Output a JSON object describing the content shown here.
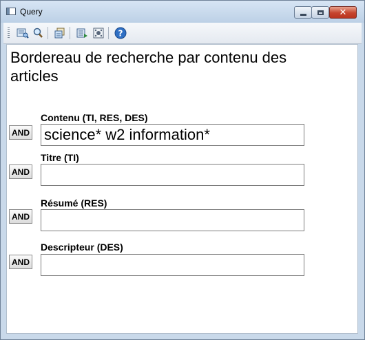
{
  "window": {
    "title": "Query"
  },
  "heading": "Bordereau de recherche par contenu des articles",
  "fields": [
    {
      "label": "Contenu (TI, RES, DES)",
      "value": "science* w2 information*",
      "operator": "AND"
    },
    {
      "label": "Titre (TI)",
      "value": "",
      "operator": "AND"
    },
    {
      "label": "Résumé (RES)",
      "value": "",
      "operator": "AND"
    },
    {
      "label": "Descripteur (DES)",
      "value": "",
      "operator": "AND"
    }
  ],
  "toolbar": {
    "icons": [
      "search-form-icon",
      "magnifier-icon",
      "history-icon",
      "export-icon",
      "settings-icon",
      "help-icon"
    ]
  },
  "colors": {
    "titlebar": "#bcd0e6",
    "close_button": "#c6442d",
    "help_icon": "#2f6fc4"
  }
}
